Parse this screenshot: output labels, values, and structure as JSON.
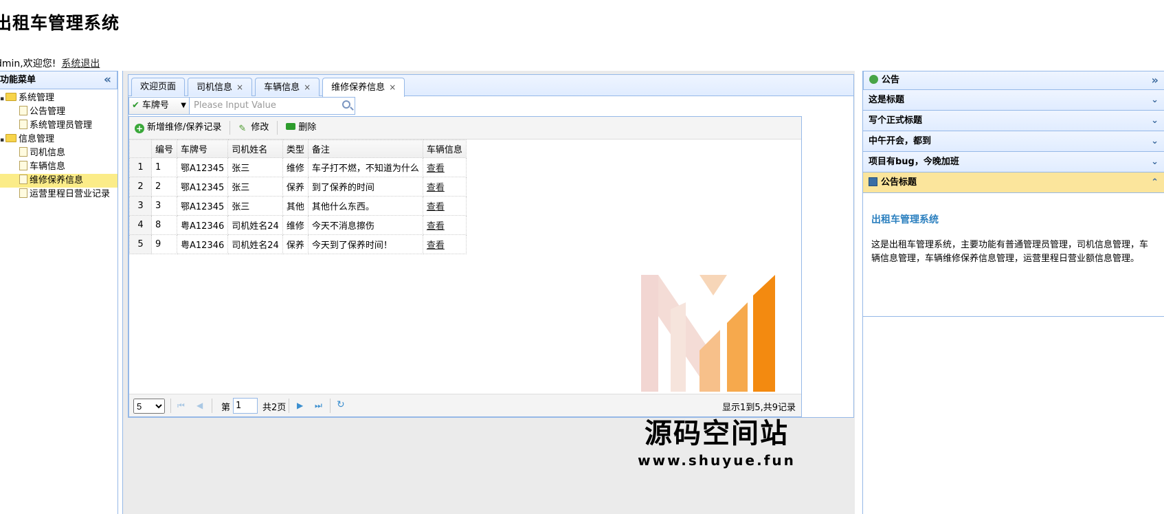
{
  "header": {
    "title": "出租车管理系统",
    "welcome": "dmin,欢迎您!",
    "logout": "系统退出"
  },
  "menu": {
    "title": "功能菜单",
    "collapse": "«",
    "groups": [
      {
        "label": "系统管理",
        "items": [
          "公告管理",
          "系统管理员管理"
        ]
      },
      {
        "label": "信息管理",
        "items": [
          "司机信息",
          "车辆信息",
          "维修保养信息",
          "运营里程日营业记录"
        ]
      }
    ]
  },
  "tabs": [
    {
      "label": "欢迎页面",
      "closable": false
    },
    {
      "label": "司机信息",
      "closable": true
    },
    {
      "label": "车辆信息",
      "closable": true
    },
    {
      "label": "维修保养信息",
      "closable": true
    }
  ],
  "search": {
    "field": "车牌号",
    "placeholder": "Please Input Value"
  },
  "toolbar": {
    "add": "新增维修/保养记录",
    "edit": "修改",
    "delete": "删除"
  },
  "table": {
    "columns": [
      "编号",
      "车牌号",
      "司机姓名",
      "类型",
      "备注",
      "车辆信息"
    ],
    "rows": [
      [
        "1",
        "1",
        "鄂A12345",
        "张三",
        "维修",
        "车子打不燃，不知道为什么",
        "查看"
      ],
      [
        "2",
        "2",
        "鄂A12345",
        "张三",
        "保养",
        "到了保养的时间",
        "查看"
      ],
      [
        "3",
        "3",
        "鄂A12345",
        "张三",
        "其他",
        "其他什么东西。",
        "查看"
      ],
      [
        "4",
        "8",
        "粤A12346",
        "司机姓名24",
        "维修",
        "今天不消息擦伤",
        "查看"
      ],
      [
        "5",
        "9",
        "粤A12346",
        "司机姓名24",
        "保养",
        "今天到了保养时间！",
        "查看"
      ]
    ]
  },
  "pager": {
    "page_size": "5",
    "page_label": "第",
    "page_value": "1",
    "total_pages": "共2页",
    "info": "显示1到5,共9记录"
  },
  "watermark": {
    "text": "源码空间站",
    "url": "www.shuyue.fun"
  },
  "notice": {
    "title": "公告",
    "items": [
      "这是标题",
      "写个正式标题",
      "中午开会，都到",
      "项目有bug，今晚加班"
    ],
    "open_item": "公告标题",
    "body_title": "出租车管理系统",
    "body_text": "这是出租车管理系统，主要功能有普通管理员管理，司机信息管理，车辆信息管理，车辆维修保养信息管理，运营里程日营业额信息管理。"
  }
}
